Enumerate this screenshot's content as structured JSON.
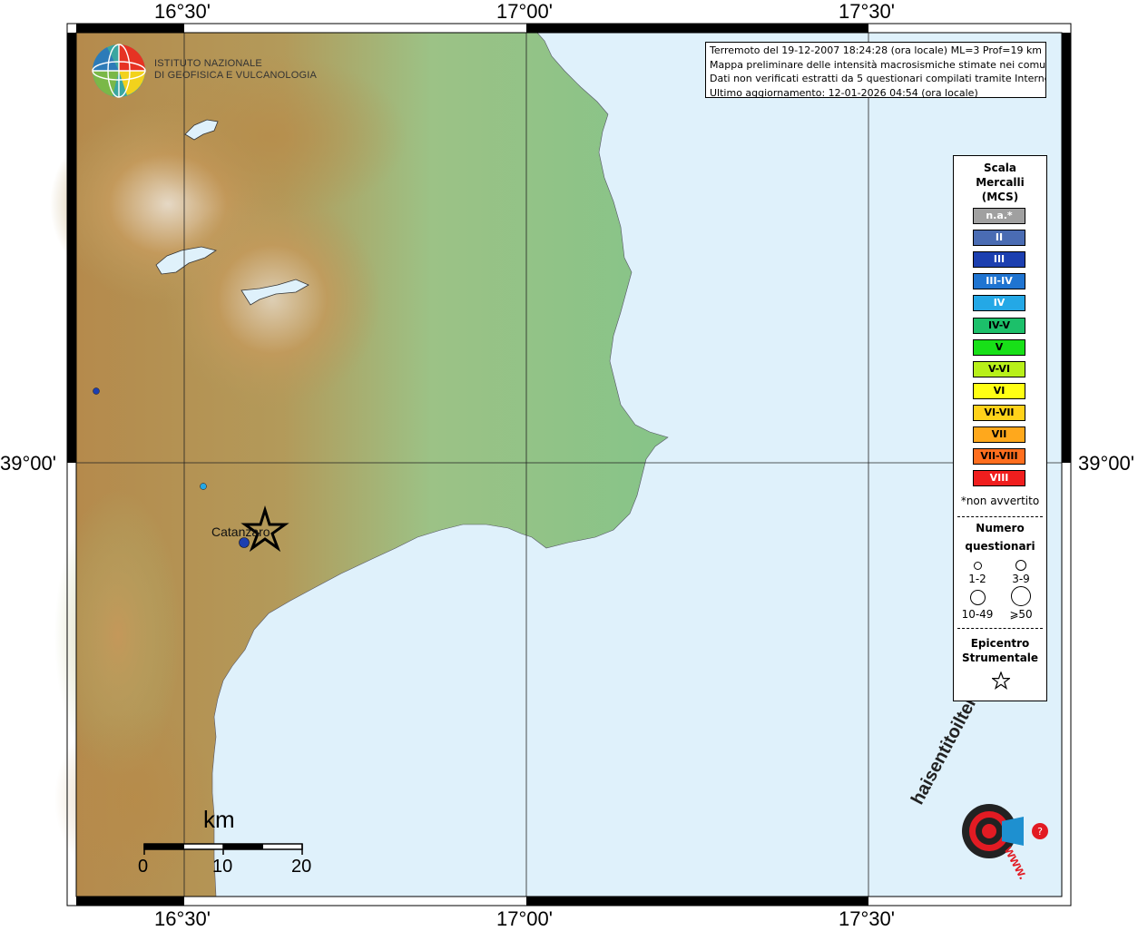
{
  "axes": {
    "top_labels": [
      "16°30'",
      "17°00'",
      "17°30'"
    ],
    "bottom_labels": [
      "16°30'",
      "17°00'",
      "17°30'"
    ],
    "left_label": "39°00'",
    "right_label": "39°00'"
  },
  "logo": {
    "line1": "ISTITUTO NAZIONALE",
    "line2": "DI GEOFISICA E VULCANOLOGIA"
  },
  "info": {
    "line1": "Terremoto del 19-12-2007 18:24:28 (ora locale) ML=3 Prof=19 km",
    "line2": "Mappa preliminare delle intensità macrosismiche stimate nei comuni",
    "line3": "Dati non verificati estratti da 5 questionari compilati tramite Internet.",
    "line4": "Ultimo aggiornamento: 12-01-2026 04:54 (ora locale)"
  },
  "legend": {
    "title_line1": "Scala",
    "title_line2": "Mercalli",
    "title_line3": "(MCS)",
    "scale": [
      {
        "label": "n.a.*",
        "color": "#a0a0a0",
        "text_color": "#ffffff"
      },
      {
        "label": "II",
        "color": "#4a6cb3",
        "text_color": "#ffffff"
      },
      {
        "label": "III",
        "color": "#1c3fb0",
        "text_color": "#ffffff"
      },
      {
        "label": "III-IV",
        "color": "#1f74d1",
        "text_color": "#ffffff"
      },
      {
        "label": "IV",
        "color": "#24a8e6",
        "text_color": "#ffffff"
      },
      {
        "label": "IV-V",
        "color": "#1cc06a",
        "text_color": "#000000"
      },
      {
        "label": "V",
        "color": "#18e018",
        "text_color": "#000000"
      },
      {
        "label": "V-VI",
        "color": "#b8f01a",
        "text_color": "#000000"
      },
      {
        "label": "VI",
        "color": "#ffff14",
        "text_color": "#000000"
      },
      {
        "label": "VI-VII",
        "color": "#ffd21a",
        "text_color": "#000000"
      },
      {
        "label": "VII",
        "color": "#ffa81c",
        "text_color": "#000000"
      },
      {
        "label": "VII-VIII",
        "color": "#ff6e1e",
        "text_color": "#000000"
      },
      {
        "label": "VIII",
        "color": "#f01e1e",
        "text_color": "#ffffff"
      }
    ],
    "not_felt_note": "*non avvertito",
    "count_title_line1": "Numero",
    "count_title_line2": "questionari",
    "count_sizes": [
      "1-2",
      "3-9",
      "10-49",
      "⩾50"
    ],
    "epicenter_title_line1": "Epicentro",
    "epicenter_title_line2": "Strumentale"
  },
  "places": {
    "catanzaro": "Catanzaro"
  },
  "scalebar": {
    "unit": "km",
    "ticks": [
      "0",
      "10",
      "20"
    ]
  },
  "brand": {
    "text": "haisentitoilterremoto.it",
    "prefix": "www.",
    "accent": "#e21b23"
  },
  "colors": {
    "sea": "#dff1fb",
    "land_low": "#8cc48a",
    "mountain": "#b48a4a"
  }
}
